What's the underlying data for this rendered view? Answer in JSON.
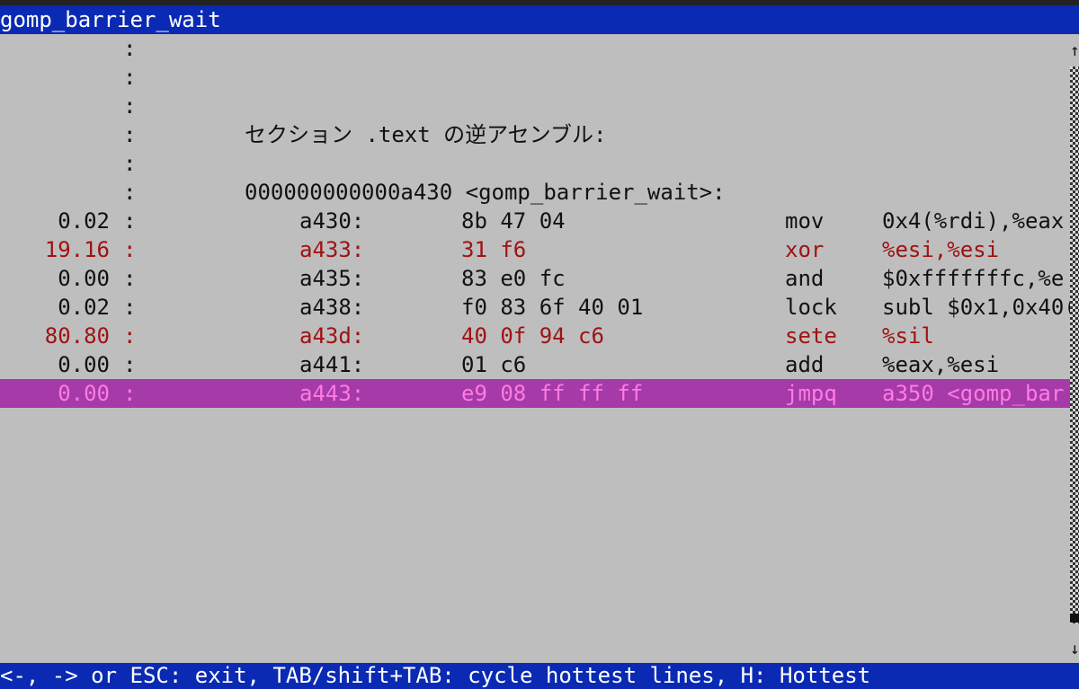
{
  "window": {
    "title": "gomp_barrier_wait"
  },
  "header_lines": [
    {
      "sep": ":",
      "text": ""
    },
    {
      "sep": ":",
      "text": ""
    },
    {
      "sep": ":",
      "text": ""
    },
    {
      "sep": ":",
      "text": "セクション .text の逆アセンブル:"
    },
    {
      "sep": ":",
      "text": ""
    },
    {
      "sep": ":",
      "text": "000000000000a430 <gomp_barrier_wait>:"
    }
  ],
  "instructions": [
    {
      "percent": "0.02",
      "sep": ":",
      "address": "a430:",
      "bytes": "8b 47 04",
      "mnemonic": "mov",
      "operands": "0x4(%rdi),%eax",
      "state": "normal"
    },
    {
      "percent": "19.16",
      "sep": ":",
      "address": "a433:",
      "bytes": "31 f6",
      "mnemonic": "xor",
      "operands": "%esi,%esi",
      "state": "hot"
    },
    {
      "percent": "0.00",
      "sep": ":",
      "address": "a435:",
      "bytes": "83 e0 fc",
      "mnemonic": "and",
      "operands": "$0xfffffffc,%e",
      "state": "normal"
    },
    {
      "percent": "0.02",
      "sep": ":",
      "address": "a438:",
      "bytes": "f0 83 6f 40 01",
      "mnemonic": "lock",
      "operands": "subl $0x1,0x40(%",
      "state": "normal"
    },
    {
      "percent": "80.80",
      "sep": ":",
      "address": "a43d:",
      "bytes": "40 0f 94 c6",
      "mnemonic": "sete",
      "operands": "%sil",
      "state": "hot"
    },
    {
      "percent": "0.00",
      "sep": ":",
      "address": "a441:",
      "bytes": "01 c6",
      "mnemonic": "add",
      "operands": "%eax,%esi",
      "state": "normal"
    },
    {
      "percent": "0.00",
      "sep": ":",
      "address": "a443:",
      "bytes": "e9 08 ff ff ff",
      "mnemonic": "jmpq",
      "operands": "a350 <gomp_bar",
      "state": "selected"
    }
  ],
  "scrollbar": {
    "up_icon": "arrow-up",
    "down_icon": "arrow-down"
  },
  "status": {
    "text": "<-, -> or ESC: exit, TAB/shift+TAB: cycle hottest lines, H: Hottest"
  },
  "colors": {
    "title_bg": "#0a2ab3",
    "background": "#bebebe",
    "hot_text": "#a01212",
    "selected_bg": "#a53aa8",
    "selected_text": "#ff7be3"
  }
}
